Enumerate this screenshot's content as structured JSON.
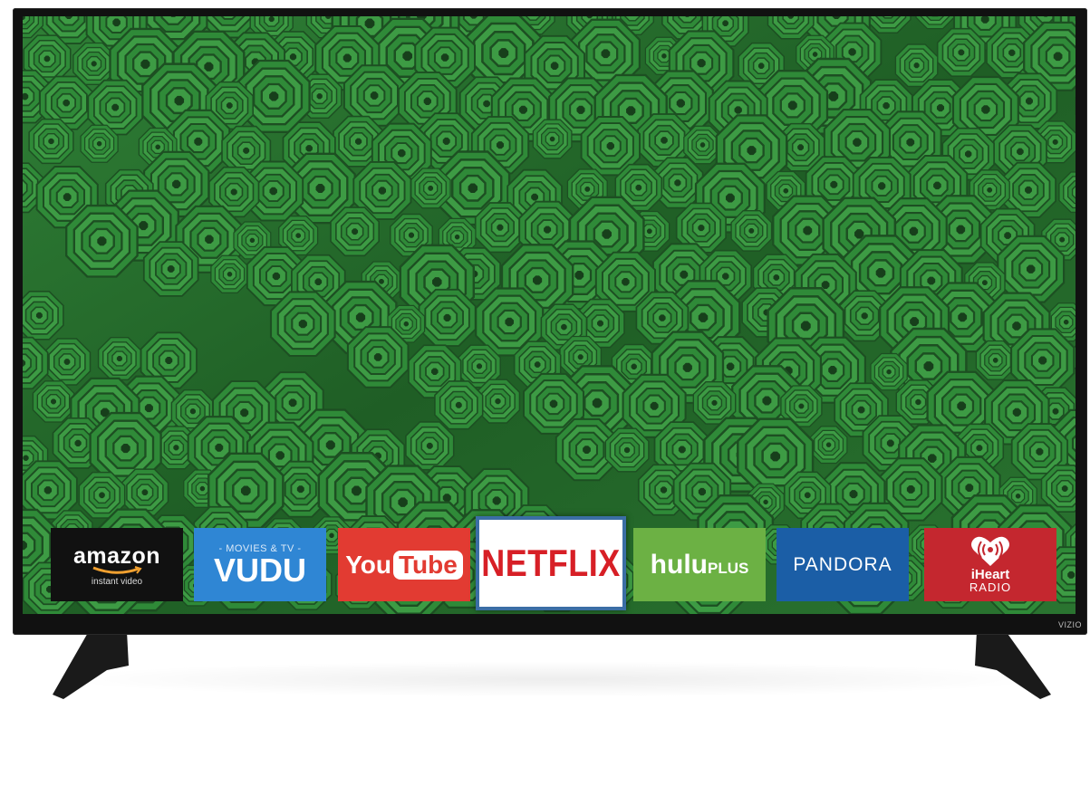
{
  "device": {
    "brand": "VIZIO"
  },
  "apps": [
    {
      "id": "amazon",
      "title": "amazon",
      "subtitle": "instant video"
    },
    {
      "id": "vudu",
      "subtitle": "- MOVIES & TV -",
      "title": "VUDU"
    },
    {
      "id": "youtube",
      "title_part1": "You",
      "title_part2": "Tube"
    },
    {
      "id": "netflix",
      "title": "NETFLIX",
      "selected": true
    },
    {
      "id": "hulu",
      "title": "hulu",
      "suffix": "PLUS"
    },
    {
      "id": "pandora",
      "title": "PANDORA"
    },
    {
      "id": "iheart",
      "title": "iHeart",
      "subtitle": "RADIO"
    }
  ],
  "colors": {
    "wallpaper": "#2e7a34",
    "selection_border": "#3b6ea5",
    "netflix_red": "#d71f26",
    "youtube_red": "#e23b32",
    "vudu_blue": "#2f86d4",
    "hulu_green": "#6cb144",
    "pandora_blue": "#1b5ea6",
    "iheart_red": "#c4272f"
  }
}
